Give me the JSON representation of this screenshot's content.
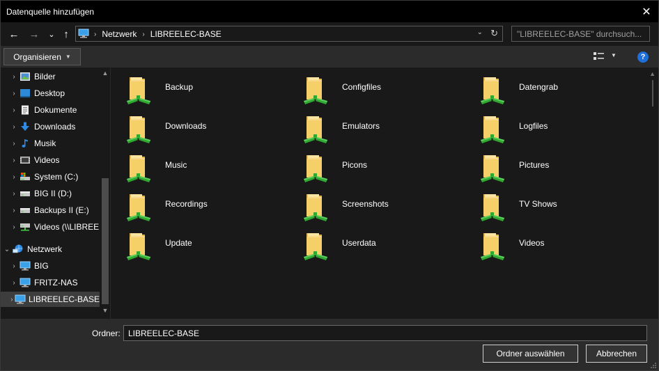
{
  "window": {
    "title": "Datenquelle hinzufügen",
    "close_glyph": "✕"
  },
  "nav": {
    "back_glyph": "←",
    "forward_glyph": "→",
    "recent_glyph": "⌄",
    "up_glyph": "↑",
    "breadcrumb": [
      "Netzwerk",
      "LIBREELEC-BASE"
    ],
    "separator": "›",
    "refresh_glyph": "↻",
    "dropdown_glyph": "⌄",
    "search_placeholder": "\"LIBREELEC-BASE\" durchsuch..."
  },
  "toolbar": {
    "organize_label": "Organisieren",
    "organize_caret": "▼",
    "view_caret": "▼",
    "help_label": "?"
  },
  "sidebar": {
    "scroll_up": "▲",
    "scroll_down": "▼",
    "items": [
      {
        "label": "Bilder",
        "icon": "pictures-icon",
        "chevron": "›"
      },
      {
        "label": "Desktop",
        "icon": "desktop-icon",
        "chevron": "›"
      },
      {
        "label": "Dokumente",
        "icon": "documents-icon",
        "chevron": "›"
      },
      {
        "label": "Downloads",
        "icon": "downloads-icon",
        "chevron": "›"
      },
      {
        "label": "Musik",
        "icon": "music-icon",
        "chevron": "›"
      },
      {
        "label": "Videos",
        "icon": "videos-icon",
        "chevron": "›"
      },
      {
        "label": "System (C:)",
        "icon": "system-drive-icon",
        "chevron": "›"
      },
      {
        "label": "BIG II (D:)",
        "icon": "drive-icon",
        "chevron": "›"
      },
      {
        "label": "Backups II (E:)",
        "icon": "drive-icon",
        "chevron": "›"
      },
      {
        "label": "Videos (\\\\LIBREE",
        "icon": "network-drive-icon",
        "chevron": "›"
      },
      {
        "label": "Netzwerk",
        "icon": "network-icon",
        "chevron": "⌄"
      },
      {
        "label": "BIG",
        "icon": "computer-icon",
        "chevron": "›"
      },
      {
        "label": "FRITZ-NAS",
        "icon": "computer-icon",
        "chevron": "›"
      },
      {
        "label": "LIBREELEC-BASE",
        "icon": "computer-icon",
        "chevron": "›",
        "selected": true
      }
    ]
  },
  "folders": [
    "Backup",
    "Configfiles",
    "Datengrab",
    "Downloads",
    "Emulators",
    "Logfiles",
    "Music",
    "Picons",
    "Pictures",
    "Recordings",
    "Screenshots",
    "TV Shows",
    "Update",
    "Userdata",
    "Videos"
  ],
  "footer": {
    "folder_label": "Ordner:",
    "folder_value": "LIBREELEC-BASE",
    "select_button": "Ordner auswählen",
    "cancel_button": "Abbrechen"
  },
  "colors": {
    "background": "#191919",
    "toolbar": "#2b2b2b",
    "accent": "#1e6fd9",
    "folder": "#f3cc6b",
    "share_pipe": "#2fa82f"
  }
}
